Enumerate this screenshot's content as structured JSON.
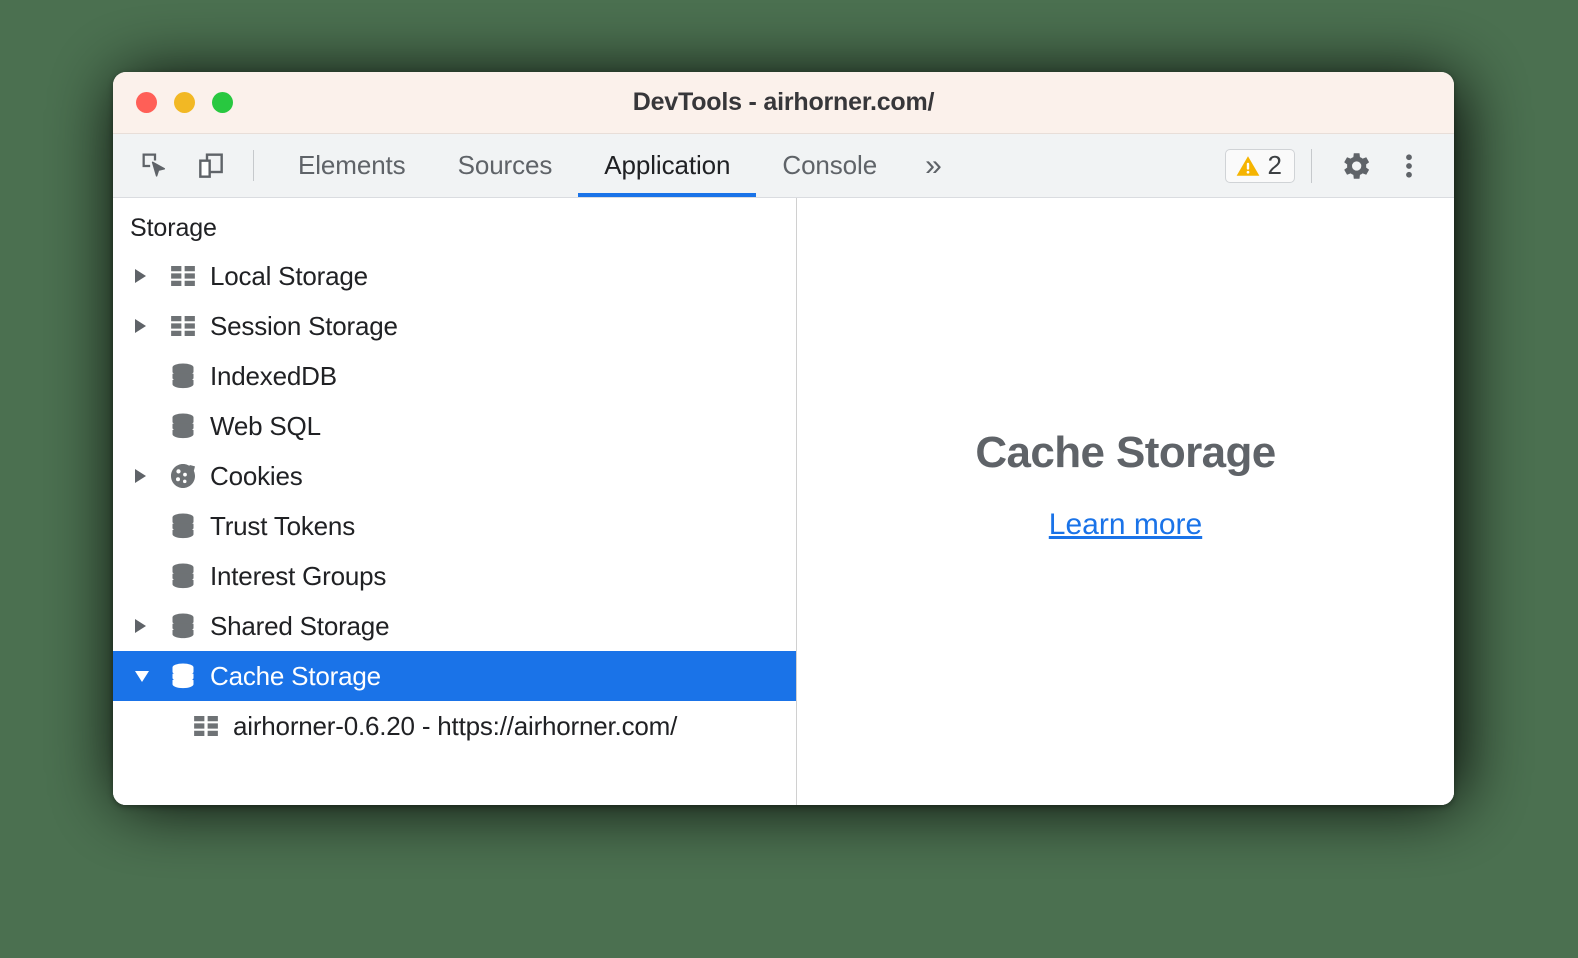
{
  "window": {
    "title": "DevTools - airhorner.com/",
    "traffic_lights": [
      {
        "name": "close",
        "color": "#ff5f57"
      },
      {
        "name": "minimize",
        "color": "#f2b824"
      },
      {
        "name": "maximize",
        "color": "#28c840"
      }
    ]
  },
  "toolbar": {
    "inspect_icon": "inspect-element-icon",
    "device_icon": "device-toolbar-icon",
    "tabs": [
      {
        "label": "Elements",
        "active": false
      },
      {
        "label": "Sources",
        "active": false
      },
      {
        "label": "Application",
        "active": true
      },
      {
        "label": "Console",
        "active": false
      }
    ],
    "more_tabs_glyph": "»",
    "warning_icon": "warning-triangle-icon",
    "warning_count": "2",
    "settings_icon": "gear-icon",
    "more_options_icon": "kebab-menu-icon",
    "accent_color": "#1a73e8"
  },
  "sidebar": {
    "section_title": "Storage",
    "items": [
      {
        "label": "Local Storage",
        "icon": "table-grid-icon",
        "twisty": "collapsed",
        "selected": false,
        "child": false
      },
      {
        "label": "Session Storage",
        "icon": "table-grid-icon",
        "twisty": "collapsed",
        "selected": false,
        "child": false
      },
      {
        "label": "IndexedDB",
        "icon": "database-icon",
        "twisty": "none",
        "selected": false,
        "child": false
      },
      {
        "label": "Web SQL",
        "icon": "database-icon",
        "twisty": "none",
        "selected": false,
        "child": false
      },
      {
        "label": "Cookies",
        "icon": "cookie-icon",
        "twisty": "collapsed",
        "selected": false,
        "child": false
      },
      {
        "label": "Trust Tokens",
        "icon": "database-icon",
        "twisty": "none",
        "selected": false,
        "child": false
      },
      {
        "label": "Interest Groups",
        "icon": "database-icon",
        "twisty": "none",
        "selected": false,
        "child": false
      },
      {
        "label": "Shared Storage",
        "icon": "database-icon",
        "twisty": "collapsed",
        "selected": false,
        "child": false
      },
      {
        "label": "Cache Storage",
        "icon": "database-icon",
        "twisty": "expanded",
        "selected": true,
        "child": false
      },
      {
        "label": "airhorner-0.6.20 - https://airhorner.com/",
        "icon": "table-grid-icon",
        "twisty": "none",
        "selected": false,
        "child": true
      }
    ]
  },
  "content": {
    "empty_title": "Cache Storage",
    "learn_more_label": "Learn more"
  }
}
